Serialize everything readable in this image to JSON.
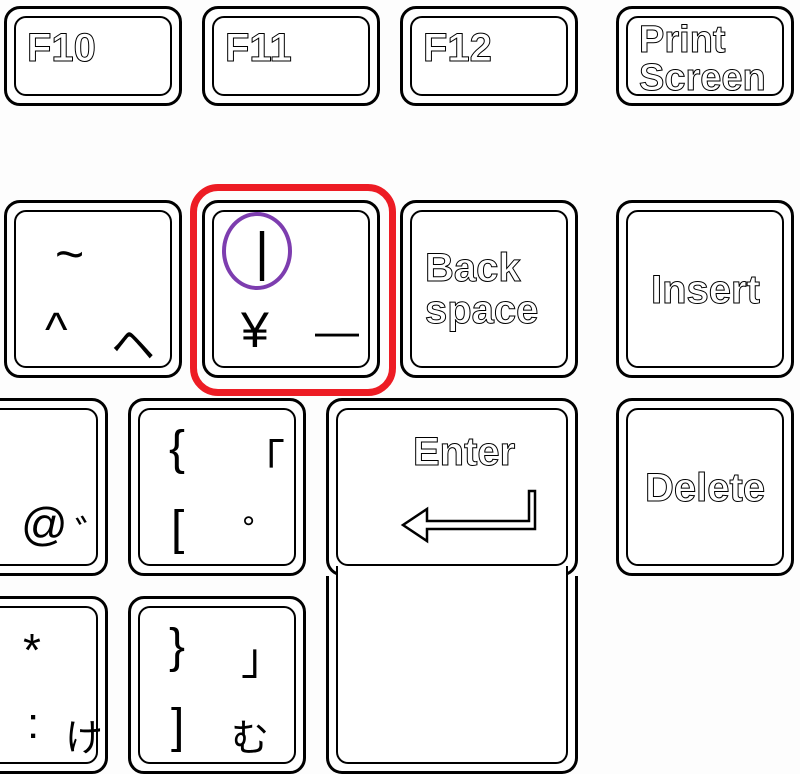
{
  "row1": {
    "f10": "F10",
    "f11": "F11",
    "f12": "F12",
    "prtsc_l1": "Print",
    "prtsc_l2": "Screen"
  },
  "row2": {
    "tilde": "~",
    "caret1": "^",
    "caret2": "ヘ",
    "yen_pipe": "|",
    "yen_sym": "¥",
    "yen_dash": "—",
    "back_l1": "Back",
    "back_l2": "space",
    "insert": "Insert"
  },
  "row3": {
    "at": "@",
    "dakuten": "゛",
    "lcurly": "{",
    "lcorner": "「",
    "lbracket": "[",
    "handaku": "゜",
    "enter": "Enter",
    "delete": "Delete"
  },
  "row4": {
    "asterisk": "*",
    "colon": ":",
    "ke": "け",
    "rcurly": "}",
    "rcorner": "」",
    "rbracket": "]",
    "mu": "む"
  }
}
